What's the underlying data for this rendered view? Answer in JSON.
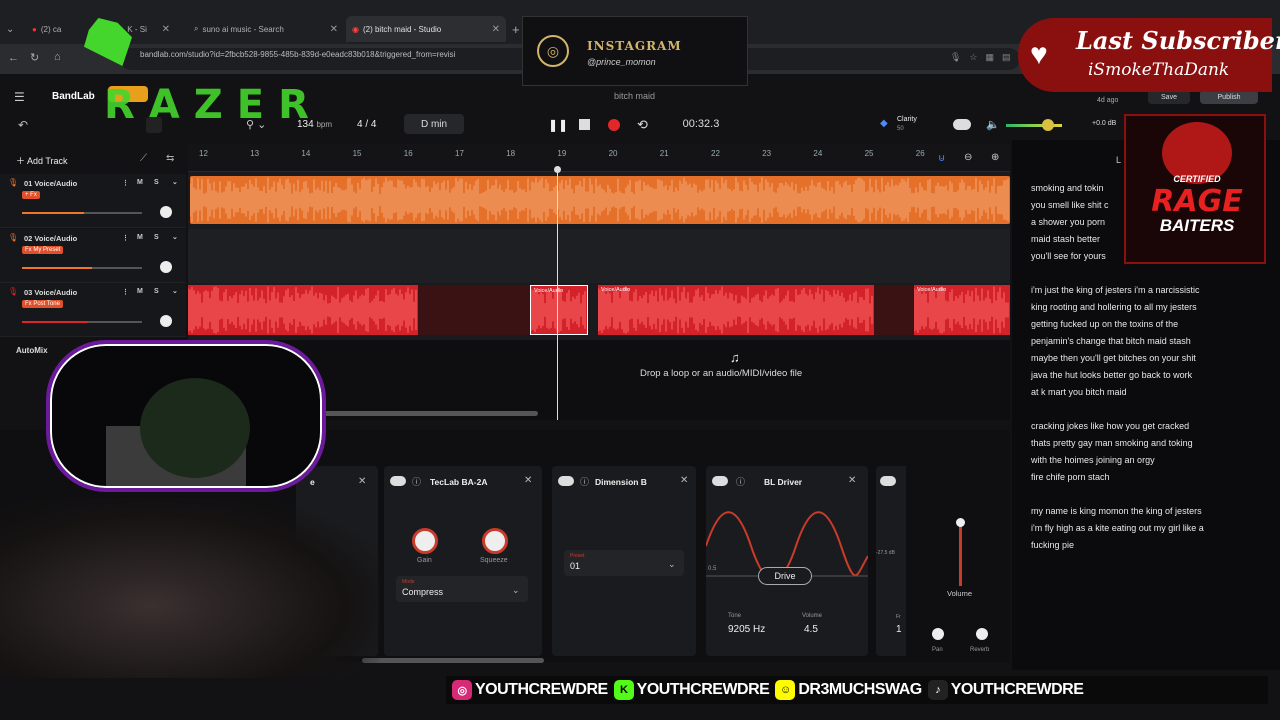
{
  "browser": {
    "tabs": [
      {
        "label": "(2) ca"
      },
      {
        "label": "K - Si"
      },
      {
        "label": "suno ai music - Search"
      },
      {
        "label": "(2) bitch maid - Studio"
      }
    ],
    "url": "bandlab.com/studio?id=2fbcb528-9855-485b-839d-e0eadc83b018&triggered_from=revisi"
  },
  "instagram": {
    "title": "INSTAGRAM",
    "handle": "@prince_momon"
  },
  "subscriber": {
    "title": "Last Subscriber",
    "name": "iSmokeThaDank"
  },
  "app": {
    "logo": "BandLab",
    "brand_overlay": "RAZER",
    "bpm_value": "134",
    "bpm_unit": "bpm",
    "time_sig": "4 / 4",
    "key": "D min",
    "project_name": "bitch maid",
    "timecode": "00:32.3",
    "clarity_label": "Clarity",
    "clarity_value": "50",
    "db_label": "+0.0 dB",
    "last_saved": "4d ago",
    "save_label": "Save",
    "publish_label": "Publish",
    "add_track_label": "Add Track",
    "automix_label": "AutoMix",
    "drop_hint": "Drop a loop or an audio/MIDI/video file"
  },
  "ruler": [
    "12",
    "13",
    "14",
    "15",
    "16",
    "17",
    "18",
    "19",
    "20",
    "21",
    "22",
    "23",
    "24",
    "25",
    "26"
  ],
  "tracks": [
    {
      "name": "01 Voice/Audio",
      "tag": "+ Fx",
      "color": "#f0752b",
      "level": 0.52
    },
    {
      "name": "02 Voice/Audio",
      "tag": "Fx My Preset",
      "color": "#f0752b",
      "level": 0.58
    },
    {
      "name": "03 Voice/Audio",
      "tag": "Fx Post Tone",
      "color": "#e0252a",
      "level": 0.55
    }
  ],
  "clip_label": "Voice/Audio",
  "effects": {
    "card1": {
      "title": "TecLab BA-2A",
      "gain_label": "Gain",
      "squeeze_label": "Squeeze",
      "mode_label": "Mode",
      "mode_value": "Compress"
    },
    "card2": {
      "title": "Dimension B",
      "preset_label": "Preset",
      "preset_value": "01"
    },
    "card3": {
      "title": "BL Driver",
      "drive_label": "Drive",
      "axis_value": "0.5",
      "tone_label": "Tone",
      "tone_value": "9205 Hz",
      "volume_label": "Volume",
      "volume_value": "4.5"
    },
    "card4": {
      "db_value": "-27.5 dB",
      "fr_label": "Fr",
      "fr_value": "1"
    },
    "partial_title": "e"
  },
  "mixer": {
    "volume_label": "Volume",
    "pan_label": "Pan",
    "reverb_label": "Reverb"
  },
  "lyrics_header": "L",
  "lyrics": [
    "smoking and tokin",
    "you smell like shit c",
    "a shower you porn",
    "maid stash  better",
    "you'll see for yours",
    "",
    "i'm just the king of jesters i'm a narcissistic",
    "king rooting and hollering  to all my jesters",
    "getting fucked up on the toxins of the",
    "penjamin's change that bitch maid stash",
    "maybe  then you'll get bitches on your shit",
    "java the hut looks better  go back to work",
    "at k mart you bitch maid",
    "",
    "cracking jokes like how you get cracked",
    "thats pretty gay man smoking and toking",
    "with the hoimes joining an orgy",
    "fire chife porn stach",
    "",
    "my name is king momon the king of jesters",
    "i'm fly high as a kite eating out my girl like a",
    "fucking pie"
  ],
  "badge": {
    "line1": "CERTIFIED",
    "line2": "RAGE",
    "line3": "BAITERS"
  },
  "socials": [
    {
      "platform": "instagram-icon",
      "handle": "YOUTHCREWDRE",
      "color": "#d62976"
    },
    {
      "platform": "kick-icon",
      "handle": "YOUTHCREWDRE",
      "color": "#53fc18"
    },
    {
      "platform": "snapchat-icon",
      "handle": "DR3MUCHSWAG",
      "color": "#fffc00"
    },
    {
      "platform": "tiktok-icon",
      "handle": "YOUTHCREWDRE",
      "color": "#222222"
    }
  ],
  "colors": {
    "orange": "#f0752b",
    "red": "#e0252a",
    "accent": "#4a8cff",
    "record": "#e02828"
  }
}
